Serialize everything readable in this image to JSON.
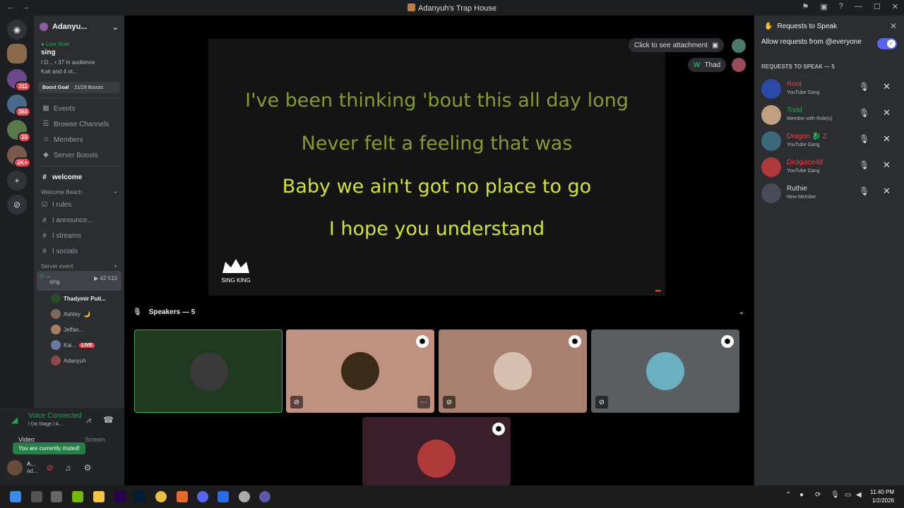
{
  "window": {
    "title": "Adanyuh's Trap House",
    "back": "←",
    "forward": "→",
    "controls": [
      "⚑",
      "▣",
      "?",
      "—",
      "☐",
      "✕"
    ]
  },
  "guilds": [
    {
      "label": "",
      "badge": ""
    },
    {
      "label": "",
      "badge": ""
    },
    {
      "label": "",
      "badge": "311"
    },
    {
      "label": "",
      "badge": "388"
    },
    {
      "label": "",
      "badge": "29"
    },
    {
      "label": "",
      "badge": "2K+"
    },
    {
      "label": "+",
      "badge": ""
    },
    {
      "label": "⊘",
      "badge": ""
    }
  ],
  "sidebar": {
    "server_name": "Adanyu...",
    "live_now": "Live Now",
    "stage_name": "sing",
    "stage_meta": "I D... • 37 in audience",
    "stage_people": "Kait and 4 ot...",
    "boost_goal": "Boost Goal",
    "boost_count": "21/28 Boosts",
    "nav": [
      "Events",
      "Browse Channels",
      "Members",
      "Server Boosts"
    ],
    "welcome": "welcome",
    "category1": "Welcome Beach",
    "channels": [
      "I rules",
      "I announce...",
      "I streams",
      "I socials"
    ],
    "category2": "Server event",
    "active_stage": {
      "label": "...",
      "sub": "sing",
      "count1": "42",
      "count2": "510"
    },
    "members": [
      {
        "name": "Thadymir Puti...",
        "extra": ""
      },
      {
        "name": "Ashley",
        "extra": "🌙"
      },
      {
        "name": "Jeffan...",
        "extra": ""
      },
      {
        "name": "Kai...",
        "extra": "LIVE"
      },
      {
        "name": "Adanyuh",
        "extra": ""
      }
    ]
  },
  "voice": {
    "status": "Voice Connected",
    "location": "I Da Stage / A...",
    "muted_tip": "You are currently muted!",
    "video_btn": "Video",
    "screen_btn": "Screen",
    "user_name": "A...",
    "user_sub": "ad..."
  },
  "stage": {
    "lyrics": [
      {
        "text": "I've been thinking 'bout this all day long",
        "color": "#8c9a2a"
      },
      {
        "text": "Never felt a feeling that was",
        "color": "#8c9a2a"
      },
      {
        "text": "Baby we ain't got no place to go",
        "color": "#d4e32a"
      },
      {
        "text": "I hope you understand",
        "color": "#d4e32a"
      }
    ],
    "attachment_label": "Click to see attachment",
    "thad_label": "Thad",
    "speakers_header": "Speakers — 5",
    "sing_king": "SING KING"
  },
  "requests": {
    "title": "Requests to Speak",
    "allow_label": "Allow requests from @everyone",
    "header": "REQUESTS TO SPEAK — 5",
    "items": [
      {
        "name": "Root",
        "role": "YouTube Gang",
        "color": "#f23f43"
      },
      {
        "name": "Todd",
        "role": "Member with Role(s)",
        "color": "#23a55a"
      },
      {
        "name": "Dragon 🐉 Z",
        "role": "YouTube Gang",
        "color": "#f23f43"
      },
      {
        "name": "Dickjuice48",
        "role": "YouTube Gang",
        "color": "#f23f43"
      },
      {
        "name": "Ruthie",
        "role": "New Member",
        "color": "#dbdee1"
      }
    ]
  },
  "taskbar": {
    "time": "11:40 PM",
    "date": "1/2/2026"
  }
}
